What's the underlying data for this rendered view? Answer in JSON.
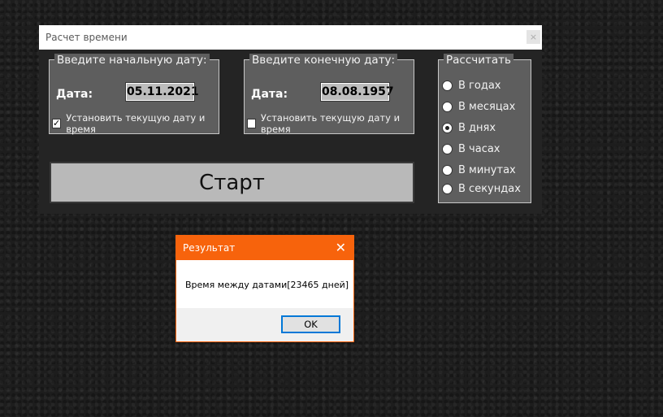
{
  "window": {
    "title": "Расчет времени",
    "close_label": "×"
  },
  "start_group": {
    "legend": "Введите начальную дату:",
    "date_label": "Дата:",
    "date_value": "05.11.2021",
    "checkbox_label": "Установить текущую дату и время",
    "checkbox_checked": true,
    "check_mark": "✓"
  },
  "end_group": {
    "legend": "Введите конечную дату:",
    "date_label": "Дата:",
    "date_value": "08.08.1957",
    "checkbox_label": "Установить текущую дату и время",
    "checkbox_checked": false
  },
  "calc_group": {
    "legend": "Рассчитать",
    "options": [
      {
        "label": "В годах",
        "checked": false
      },
      {
        "label": "В месяцах",
        "checked": false
      },
      {
        "label": "В днях",
        "checked": true
      },
      {
        "label": "В часах",
        "checked": false
      },
      {
        "label": "В минутах",
        "checked": false
      },
      {
        "label": "В секундах",
        "checked": false
      }
    ]
  },
  "start_button": {
    "label": "Старт"
  },
  "dialog": {
    "title": "Результат",
    "close_label": "✕",
    "message": "Время между датами[23465 дней]",
    "ok_label": "OK"
  },
  "colors": {
    "dialog_accent": "#f7630c",
    "focus_border": "#0078d7"
  }
}
